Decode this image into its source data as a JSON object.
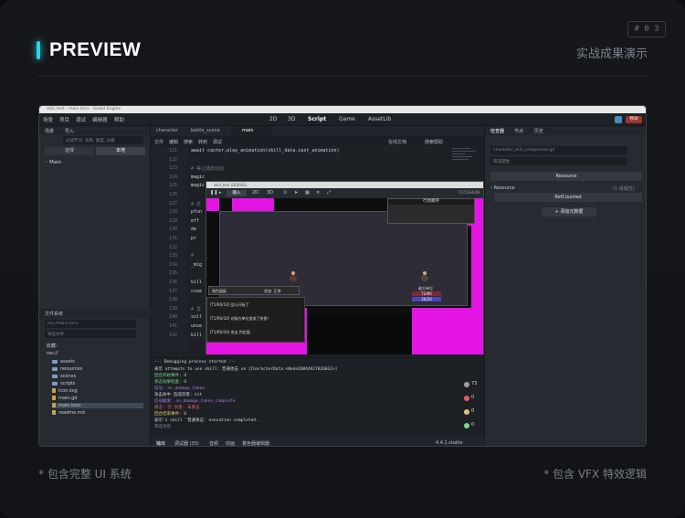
{
  "slide": {
    "title": "PREVIEW",
    "page_number": "# 0 3",
    "subtitle": "实战成果演示",
    "caption_left": "* 包含完整 UI 系统",
    "caption_right": "* 包含 VFX 特效逻辑",
    "accent_color": "#2fd4e8"
  },
  "editor": {
    "window_title": "skill_test - main.tscn - Godot Engine",
    "menus": [
      "场景",
      "项目",
      "调试",
      "编辑器",
      "帮助"
    ],
    "workspaces": [
      "2D",
      "3D",
      "Script",
      "Game",
      "AssetLib"
    ],
    "active_workspace": "Script",
    "renderer_label": "移动",
    "scene_dock": {
      "tabs": [
        "场景",
        "导入"
      ],
      "filter_placeholder": "过滤节点: 名称, 类型, 分组",
      "modes": [
        "2D场景",
        "3D场景"
      ],
      "mode_labels": [
        "选择",
        "本地"
      ],
      "root_node": "Main"
    },
    "filesystem": {
      "title": "文件系统",
      "path": "res://main.tscn",
      "filter_placeholder": "筛选文件",
      "favorites": "收藏：",
      "root": "res://",
      "items": [
        {
          "name": "assets",
          "type": "folder"
        },
        {
          "name": "resources",
          "type": "folder"
        },
        {
          "name": "scenes",
          "type": "folder"
        },
        {
          "name": "scripts",
          "type": "folder"
        },
        {
          "name": "icon.svg",
          "type": "file"
        },
        {
          "name": "main.gd",
          "type": "file"
        },
        {
          "name": "main.tscn",
          "type": "file",
          "selected": true
        },
        {
          "name": "readme.md",
          "type": "file"
        }
      ]
    },
    "script_editor": {
      "tabs": [
        "character",
        "battle_scene",
        "main"
      ],
      "active_tab": "main",
      "menus": [
        "文件",
        "编辑",
        "搜索",
        "转到",
        "调试"
      ],
      "right_menus": [
        "在线文档",
        "搜索帮助"
      ],
      "lines": [
        {
          "n": "121",
          "code": "await caster.play_animation(skill_data.cast_animation)"
        },
        {
          "n": "122",
          "code": ""
        },
        {
          "n": "123",
          "code": "# 等让播放动画"
        },
        {
          "n": "124",
          "code": "magic"
        },
        {
          "n": "125",
          "code": "magic"
        },
        {
          "n": "126",
          "code": ""
        },
        {
          "n": "127",
          "code": "# 处"
        },
        {
          "n": "128",
          "code": "pfun"
        },
        {
          "n": "129",
          "code": "eff"
        },
        {
          "n": "130",
          "code": "de"
        },
        {
          "n": "131",
          "code": "pr"
        },
        {
          "n": "132",
          "code": ""
        },
        {
          "n": "133",
          "code": "# "
        },
        {
          "n": "134",
          "code": "_mig"
        },
        {
          "n": "135",
          "code": ""
        },
        {
          "n": "136",
          "code": "kill"
        },
        {
          "n": "137",
          "code": "ccee"
        },
        {
          "n": "138",
          "code": ""
        },
        {
          "n": "139",
          "code": "# 发"
        },
        {
          "n": "140",
          "code": "sult"
        },
        {
          "n": "141",
          "code": "unse"
        },
        {
          "n": "142",
          "code": "kill"
        }
      ]
    },
    "game_window": {
      "title": "skill_test (DEBUG)",
      "input_label": "输入",
      "modes": [
        "2D",
        "3D"
      ],
      "resolution": "1152x648",
      "battle_order_title": "行动顺序",
      "player_panel_title": "角色面板",
      "enemy_label": "敌方单位",
      "hp_label": "72/90",
      "mp_label": "20/20",
      "status_text": "状态: 正常",
      "log_lines": [
        "[T1/R0/10] 战斗开始了",
        "[T1/R0/10] 对敌方单位造成了伤害！",
        "[T1/R0/10] 攻击 判定值"
      ]
    },
    "output": {
      "lines": [
        {
          "text": "--- Debugging process started ---",
          "color": "w"
        },
        {
          "text": "表示 attempts to use skill: 普通攻击 on [CharacterData:<Node2D#44927826032>]",
          "color": "w"
        },
        {
          "text": "回合开始事件: 0",
          "color": "g"
        },
        {
          "text": "状态效果检查: 0",
          "color": "g"
        },
        {
          "text": "信号: on_damage_taken",
          "color": "p"
        },
        {
          "text": "攻击命中 造成伤害: hit",
          "color": "w"
        },
        {
          "text": "信号触发: on_damage_taken_complete",
          "color": "p"
        },
        {
          "text": "暴击: 否 伤害: 未暴击",
          "color": "r"
        },
        {
          "text": "回合结束事件: 0",
          "color": "y"
        },
        {
          "text": "表示's skill '普通攻击' execution completed.",
          "color": "w"
        }
      ],
      "filter_placeholder": "筛选消息",
      "counters": [
        "73",
        "0",
        "0",
        "0"
      ]
    },
    "status_tabs": [
      "输出",
      "调试器 (35)",
      "音频",
      "动画",
      "着色器编辑器"
    ],
    "version": "4.4.1.stable",
    "inspector": {
      "tabs": [
        "检查器",
        "节点",
        "历史"
      ],
      "resource_file": "character_skill_component.gd",
      "filter_placeholder": "筛选属性",
      "resource_btn": "Resource",
      "section": "Resource",
      "section_count": "(1 组属性)",
      "ref_counted": "RefCounted",
      "add_metadata": "+ 添加元数据"
    }
  }
}
